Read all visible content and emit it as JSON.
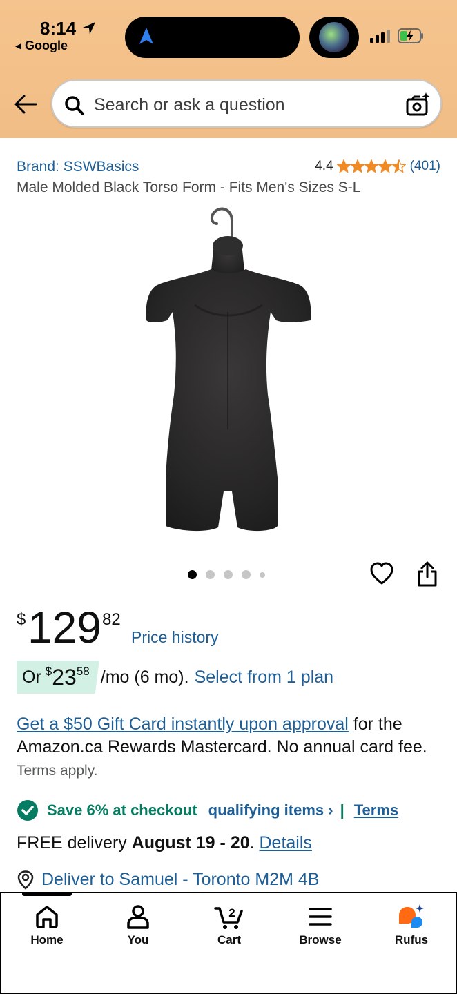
{
  "status_bar": {
    "time": "8:14",
    "back_app": "◂ Google"
  },
  "search": {
    "placeholder": "Search or ask a question"
  },
  "product": {
    "brand": "Brand: SSWBasics",
    "rating": "4.4",
    "stars": 4.5,
    "rating_count": "(401)",
    "title": "Male Molded Black Torso Form - Fits Men's Sizes S-L",
    "image_count": 5,
    "active_image": 1
  },
  "price": {
    "symbol": "$",
    "whole": "129",
    "fraction": "82",
    "history_link": "Price history"
  },
  "installment": {
    "prefix": "Or",
    "symbol": "$",
    "whole": "23",
    "fraction": "58",
    "term": "/mo (6 mo).",
    "link": "Select from 1 plan"
  },
  "card_offer": {
    "link": "Get a $50 Gift Card instantly upon approval",
    "text": " for the Amazon.ca Rewards Mastercard. No annual card fee.",
    "terms": "Terms apply."
  },
  "savings": {
    "text": "Save 6% at checkout",
    "qualifying": "qualifying items ›",
    "separator": "|",
    "terms": "Terms"
  },
  "delivery": {
    "prefix": "FREE delivery ",
    "dates": "August 19 - 20",
    "suffix": ". ",
    "details": "Details"
  },
  "deliver_to": "Deliver to Samuel - Toronto M2M 4B",
  "bottom_nav": {
    "home": "Home",
    "you": "You",
    "cart": "Cart",
    "cart_count": "2",
    "browse": "Browse",
    "rufus": "Rufus"
  },
  "colors": {
    "header_bg": "#f3c089",
    "link": "#1f5f98",
    "star": "#f08a24",
    "save_green": "#067d62",
    "installment_bg": "#d3f0e5"
  }
}
